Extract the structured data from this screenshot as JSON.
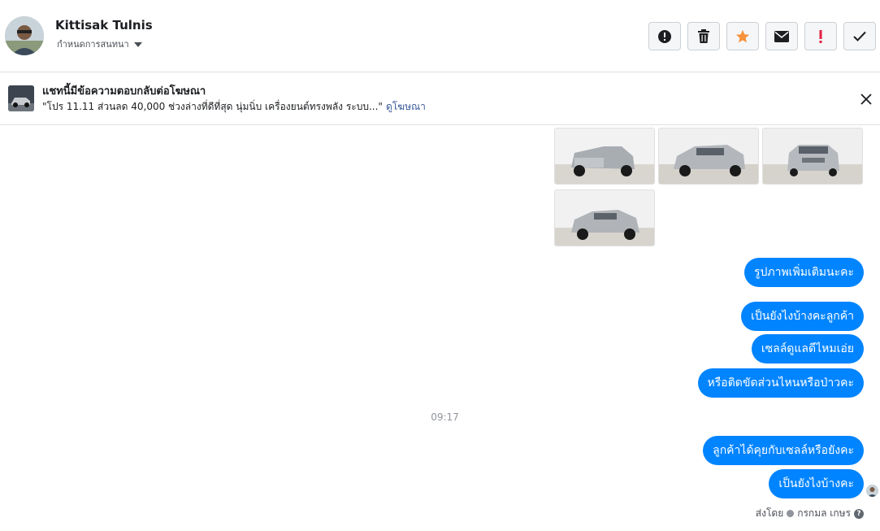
{
  "header": {
    "contact_name": "Kittisak Tulnis",
    "assign_label": "กำหนดการสนทนา",
    "toolbar": [
      {
        "name": "report-icon"
      },
      {
        "name": "trash-icon"
      },
      {
        "name": "star-icon",
        "color": "#f7923a"
      },
      {
        "name": "mail-icon"
      },
      {
        "name": "priority-icon",
        "color": "#e41e3f"
      },
      {
        "name": "check-icon"
      }
    ]
  },
  "ad": {
    "title": "แชทนี้มีข้อความตอบกลับต่อโฆษณา",
    "text": "\"โปร 11.11 ส่วนลด 40,000 ช่วงล่างที่ดีที่สุด นุ่มนิ่บ เครื่องยนต์ทรงพลัง ระบบ...\"",
    "link": "ดูโฆษณา"
  },
  "messages": [
    "รูปภาพเพิ่มเติมนะคะ",
    "เป็นยังไงบ้างคะลูกค้า",
    "เซลล์ดูแลดีไหมเอ่ย",
    "หรือติดขัดส่วนไหนหรือป่าวคะ",
    "ลูกค้าได้คุยกับเซลล์หรือยังคะ",
    "เป็นยังไงบ้างคะ"
  ],
  "timestamp": "09:17",
  "footer": {
    "sent_by_label": "ส่งโดย",
    "sender": "กรกมล เกษร"
  },
  "colors": {
    "bubble": "#0084ff",
    "link": "#385898"
  }
}
